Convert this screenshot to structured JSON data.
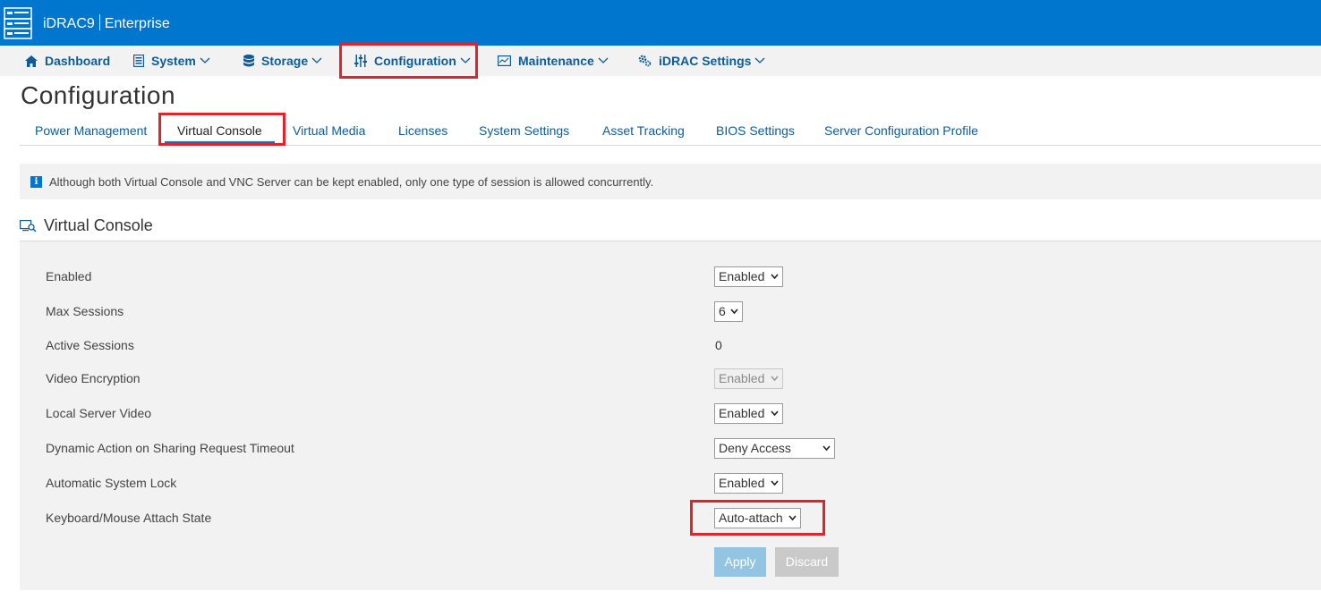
{
  "header": {
    "product": "iDRAC9",
    "edition": "Enterprise",
    "logo_icon": "server-rack-icon",
    "background": "#0076ce"
  },
  "nav": {
    "items": [
      {
        "label": "Dashboard",
        "icon": "home-icon"
      },
      {
        "label": "System",
        "icon": "server-icon"
      },
      {
        "label": "Storage",
        "icon": "database-icon"
      },
      {
        "label": "Configuration",
        "icon": "sliders-icon"
      },
      {
        "label": "Maintenance",
        "icon": "monitor-icon"
      },
      {
        "label": "iDRAC Settings",
        "icon": "gears-icon"
      }
    ]
  },
  "page": {
    "title": "Configuration"
  },
  "tabs": [
    {
      "label": "Power Management"
    },
    {
      "label": "Virtual Console"
    },
    {
      "label": "Virtual Media"
    },
    {
      "label": "Licenses"
    },
    {
      "label": "System Settings"
    },
    {
      "label": "Asset Tracking"
    },
    {
      "label": "BIOS Settings"
    },
    {
      "label": "Server Configuration Profile"
    }
  ],
  "active_tab": "Virtual Console",
  "info_message": "Although both Virtual Console and VNC Server can be kept enabled, only one type of session is allowed concurrently.",
  "section": {
    "title": "Virtual Console",
    "icon": "console-search-icon"
  },
  "settings": [
    {
      "label": "Enabled",
      "value": "Enabled",
      "type": "select"
    },
    {
      "label": "Max Sessions",
      "value": "6",
      "type": "select"
    },
    {
      "label": "Active Sessions",
      "value": "0",
      "type": "text"
    },
    {
      "label": "Video Encryption",
      "value": "Enabled",
      "type": "select-disabled"
    },
    {
      "label": "Local Server Video",
      "value": "Enabled",
      "type": "select"
    },
    {
      "label": "Dynamic Action on Sharing Request Timeout",
      "value": "Deny Access",
      "type": "select"
    },
    {
      "label": "Automatic System Lock",
      "value": "Enabled",
      "type": "select"
    },
    {
      "label": "Keyboard/Mouse Attach State",
      "value": "Auto-attach",
      "type": "select"
    }
  ],
  "buttons": {
    "apply": "Apply",
    "discard": "Discard"
  },
  "highlight_color": "#e1232b"
}
